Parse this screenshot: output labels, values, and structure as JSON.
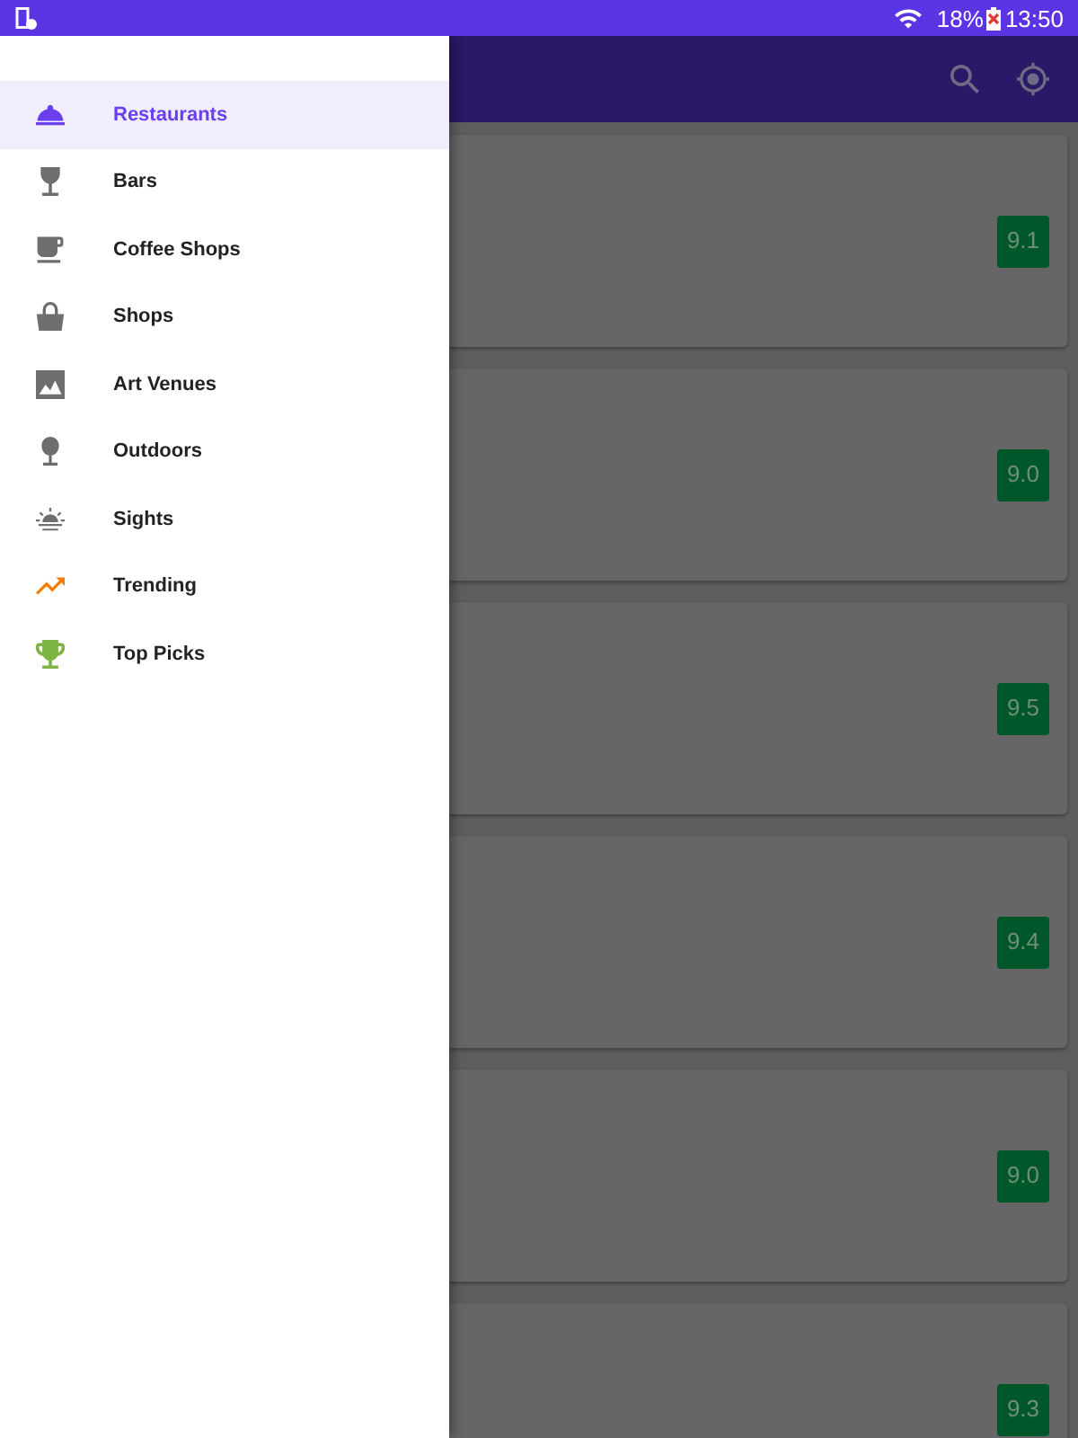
{
  "status_bar": {
    "battery": "18%",
    "time": "13:50"
  },
  "drawer": {
    "items": [
      {
        "label": "Restaurants",
        "selected": true,
        "color": "#6b3ff0"
      },
      {
        "label": "Bars",
        "selected": false,
        "color": "#6e6e6e"
      },
      {
        "label": "Coffee Shops",
        "selected": false,
        "color": "#6e6e6e"
      },
      {
        "label": "Shops",
        "selected": false,
        "color": "#6e6e6e"
      },
      {
        "label": "Art Venues",
        "selected": false,
        "color": "#6e6e6e"
      },
      {
        "label": "Outdoors",
        "selected": false,
        "color": "#6e6e6e"
      },
      {
        "label": "Sights",
        "selected": false,
        "color": "#6e6e6e"
      },
      {
        "label": "Trending",
        "selected": false,
        "color": "#f57c00"
      },
      {
        "label": "Top Picks",
        "selected": false,
        "color": "#7cb342"
      }
    ]
  },
  "venues": [
    {
      "rating": "9.1"
    },
    {
      "rating": "9.0"
    },
    {
      "rating": "9.5"
    },
    {
      "rating": "9.4"
    },
    {
      "rating": "9.0"
    },
    {
      "rating": "9.3"
    }
  ]
}
